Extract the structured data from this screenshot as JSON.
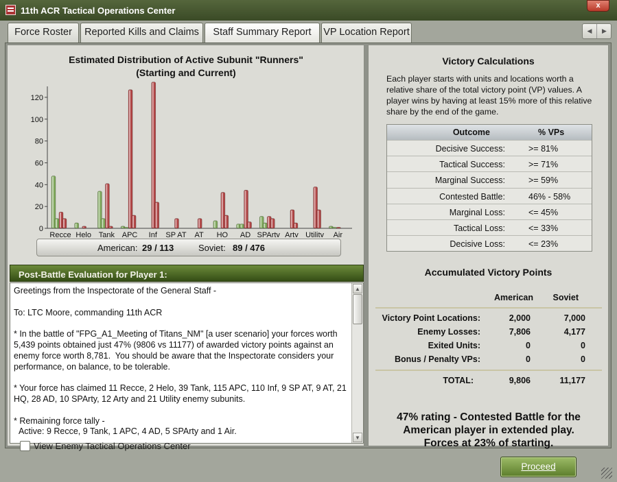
{
  "window": {
    "title": "11th ACR Tactical Operations Center",
    "close_label": "x"
  },
  "tabs": [
    {
      "label": "Force Roster",
      "active": false
    },
    {
      "label": "Reported Kills and Claims",
      "active": false
    },
    {
      "label": "Staff Summary Report",
      "active": true
    },
    {
      "label": "VP Location Report",
      "active": false
    }
  ],
  "chart": {
    "title_line1": "Estimated Distribution of Active Subunit \"Runners\"",
    "title_line2": "(Starting and Current)"
  },
  "chart_data": {
    "type": "bar",
    "title": "Estimated Distribution of Active Subunit \"Runners\" (Starting and Current)",
    "categories": [
      "Recce",
      "Helo",
      "Tank",
      "APC",
      "Inf",
      "SP AT",
      "AT",
      "HQ",
      "AD",
      "SPArty",
      "Arty",
      "Utility",
      "Air"
    ],
    "ylim": [
      0,
      130
    ],
    "yticks": [
      0,
      20,
      40,
      60,
      80,
      100,
      120
    ],
    "series": [
      {
        "name": "American",
        "color": "#7fa85c",
        "start": [
          48,
          5,
          34,
          2,
          0,
          0,
          0,
          7,
          4,
          11,
          0,
          0,
          2
        ],
        "current": [
          9,
          0,
          9,
          1,
          0,
          0,
          0,
          0,
          4,
          5,
          0,
          0,
          1
        ]
      },
      {
        "name": "Soviet",
        "color": "#b04545",
        "start": [
          15,
          2,
          41,
          127,
          134,
          9,
          9,
          33,
          35,
          11,
          17,
          38,
          1
        ],
        "current": [
          9,
          0,
          2,
          12,
          24,
          0,
          0,
          12,
          6,
          9,
          5,
          17,
          0
        ]
      }
    ]
  },
  "score": {
    "american_label": "American:",
    "american_value": "29 / 113",
    "soviet_label": "Soviet:",
    "soviet_value": "89 / 476"
  },
  "evaluation": {
    "header": "Post-Battle Evaluation for Player 1:",
    "text": "Greetings from the Inspectorate of the General Staff -\n\nTo: LTC Moore, commanding 11th ACR\n\n* In the battle of \"FPG_A1_Meeting of Titans_NM\" [a user scenario] your forces worth 5,439 points obtained just 47% (9806 vs 11177) of awarded victory points against an enemy force worth 8,781.  You should be aware that the Inspectorate considers your performance, on balance, to be tolerable.\n\n* Your force has claimed 11 Recce, 2 Helo, 39 Tank, 115 APC, 110 Inf, 9 SP AT, 9 AT, 21 HQ, 28 AD, 10 SPArty, 12 Arty and 21 Utility enemy subunits.\n\n* Remaining force tally -\n  Active: 9 Recce, 9 Tank, 1 APC, 4 AD, 5 SPArty and 1 Air."
  },
  "victory_calc": {
    "title": "Victory Calculations",
    "description": "Each player starts with units and locations worth a relative share of the total victory point (VP) values. A player wins by having at least 15% more of this relative share by the end of the game.",
    "header_outcome": "Outcome",
    "header_vps": "% VPs",
    "rows": [
      {
        "outcome": "Decisive Success:",
        "vps": ">= 81%"
      },
      {
        "outcome": "Tactical Success:",
        "vps": ">= 71%"
      },
      {
        "outcome": "Marginal Success:",
        "vps": ">= 59%"
      },
      {
        "outcome": "Contested Battle:",
        "vps": "46% - 58%"
      },
      {
        "outcome": "Marginal Loss:",
        "vps": "<= 45%"
      },
      {
        "outcome": "Tactical Loss:",
        "vps": "<= 33%"
      },
      {
        "outcome": "Decisive Loss:",
        "vps": "<= 23%"
      }
    ]
  },
  "accumulated": {
    "title": "Accumulated Victory Points",
    "col_american": "American",
    "col_soviet": "Soviet",
    "rows": [
      {
        "label": "Victory Point Locations:",
        "american": "2,000",
        "soviet": "7,000"
      },
      {
        "label": "Enemy Losses:",
        "american": "7,806",
        "soviet": "4,177"
      },
      {
        "label": "Exited Units:",
        "american": "0",
        "soviet": "0"
      },
      {
        "label": "Bonus / Penalty VPs:",
        "american": "0",
        "soviet": "0"
      }
    ],
    "total_label": "TOTAL:",
    "total_american": "9,806",
    "total_soviet": "11,177"
  },
  "rating": {
    "line1": "47% rating - Contested Battle for the",
    "line2": "American player in extended play.",
    "line3": "Forces at 23% of starting."
  },
  "footer": {
    "checkbox_label": "View Enemy Tactical Operations Center",
    "checkbox_checked": false,
    "proceed_label": "Proceed"
  }
}
